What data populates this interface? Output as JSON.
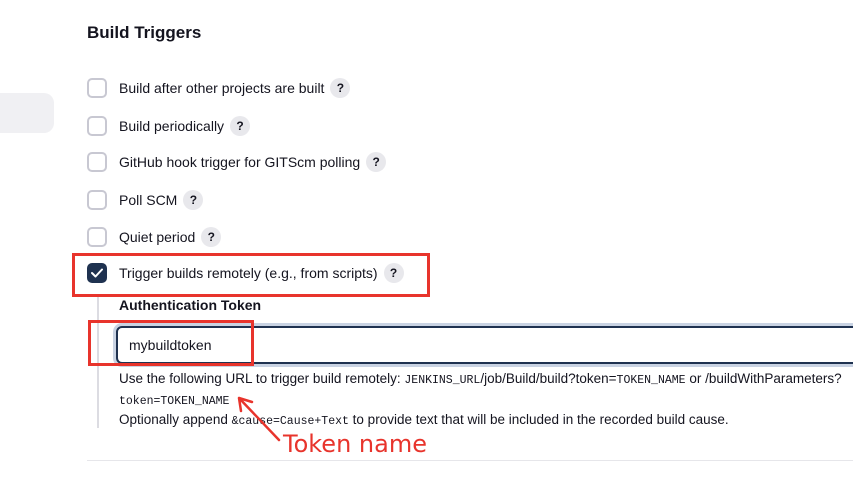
{
  "section": {
    "title": "Build Triggers"
  },
  "triggers": [
    {
      "label": "Build after other projects are built",
      "checked": false,
      "help": "?"
    },
    {
      "label": "Build periodically",
      "checked": false,
      "help": "?"
    },
    {
      "label": "GitHub hook trigger for GITScm polling",
      "checked": false,
      "help": "?"
    },
    {
      "label": "Poll SCM",
      "checked": false,
      "help": "?"
    },
    {
      "label": "Quiet period",
      "checked": false,
      "help": "?"
    },
    {
      "label": "Trigger builds remotely (e.g., from scripts)",
      "checked": true,
      "help": "?"
    }
  ],
  "auth_token": {
    "label": "Authentication Token",
    "value": "mybuildtoken"
  },
  "description": {
    "line1_prefix": "Use the following URL to trigger build remotely: ",
    "line1_code1": "JENKINS_URL",
    "line1_mid": "/job/Build/build?token=",
    "line1_code2": "TOKEN_NAME",
    "line1_suffix": " or /buildWithParameters?",
    "line2_code": "token=TOKEN_NAME",
    "line3_prefix": "Optionally append ",
    "line3_code": "&cause=Cause+Text",
    "line3_suffix": " to provide text that will be included in the recorded build cause."
  },
  "annotation": {
    "text": "Token name",
    "color": "#e8342c"
  },
  "colors": {
    "accent": "#1f3250",
    "highlight": "#e8342c"
  }
}
